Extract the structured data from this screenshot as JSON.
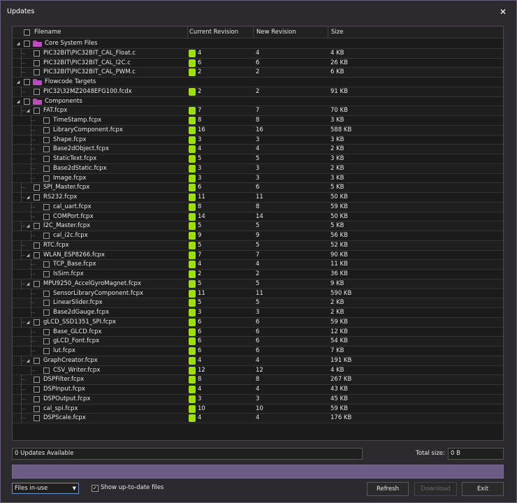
{
  "window": {
    "title": "Updates",
    "close_glyph": "✕"
  },
  "columns": {
    "filename": "Filename",
    "current": "Current Revision",
    "new": "New Revision",
    "size": "Size"
  },
  "colors": {
    "badge": "#9ee00f",
    "folder": "#c04bc0",
    "accent": "#6b5c85"
  },
  "rows": [
    {
      "level": 0,
      "expand": "collapse",
      "folder": true,
      "name": "Core System Files",
      "cur": "",
      "new": "",
      "size": ""
    },
    {
      "level": 1,
      "expand": "",
      "folder": false,
      "name": "PIC32BIT\\PIC32BIT_CAL_Float.c",
      "cur": "4",
      "new": "4",
      "size": "4 KB"
    },
    {
      "level": 1,
      "expand": "",
      "folder": false,
      "name": "PIC32BIT\\PIC32BIT_CAL_I2C.c",
      "cur": "6",
      "new": "6",
      "size": "26 KB"
    },
    {
      "level": 1,
      "expand": "",
      "folder": false,
      "name": "PIC32BIT\\PIC32BIT_CAL_PWM.c",
      "cur": "2",
      "new": "2",
      "size": "6 KB"
    },
    {
      "level": 0,
      "expand": "collapse",
      "folder": true,
      "name": "Flowcode Targets",
      "cur": "",
      "new": "",
      "size": ""
    },
    {
      "level": 1,
      "expand": "",
      "folder": false,
      "name": "PIC32\\32MZ2048EFG100.fcdx",
      "cur": "2",
      "new": "2",
      "size": "91 KB"
    },
    {
      "level": 0,
      "expand": "collapse",
      "folder": true,
      "name": "Components",
      "cur": "",
      "new": "",
      "size": ""
    },
    {
      "level": 1,
      "expand": "collapse",
      "folder": false,
      "name": "FAT.fcpx",
      "cur": "7",
      "new": "7",
      "size": "70 KB"
    },
    {
      "level": 2,
      "expand": "",
      "folder": false,
      "name": "TimeStamp.fcpx",
      "cur": "8",
      "new": "8",
      "size": "3 KB"
    },
    {
      "level": 2,
      "expand": "",
      "folder": false,
      "name": "LibraryComponent.fcpx",
      "cur": "16",
      "new": "16",
      "size": "588 KB"
    },
    {
      "level": 2,
      "expand": "",
      "folder": false,
      "name": "Shape.fcpx",
      "cur": "3",
      "new": "3",
      "size": "3 KB"
    },
    {
      "level": 2,
      "expand": "",
      "folder": false,
      "name": "Base2dObject.fcpx",
      "cur": "4",
      "new": "4",
      "size": "2 KB"
    },
    {
      "level": 2,
      "expand": "",
      "folder": false,
      "name": "StaticText.fcpx",
      "cur": "5",
      "new": "5",
      "size": "3 KB"
    },
    {
      "level": 2,
      "expand": "",
      "folder": false,
      "name": "Base2dStatic.fcpx",
      "cur": "3",
      "new": "3",
      "size": "2 KB"
    },
    {
      "level": 2,
      "expand": "",
      "folder": false,
      "name": "Image.fcpx",
      "cur": "3",
      "new": "3",
      "size": "3 KB"
    },
    {
      "level": 1,
      "expand": "",
      "folder": false,
      "name": "SPI_Master.fcpx",
      "cur": "6",
      "new": "6",
      "size": "5 KB"
    },
    {
      "level": 1,
      "expand": "collapse",
      "folder": false,
      "name": "RS232.fcpx",
      "cur": "11",
      "new": "11",
      "size": "50 KB"
    },
    {
      "level": 2,
      "expand": "",
      "folder": false,
      "name": "cal_uart.fcpx",
      "cur": "8",
      "new": "8",
      "size": "59 KB"
    },
    {
      "level": 2,
      "expand": "",
      "folder": false,
      "name": "COMPort.fcpx",
      "cur": "14",
      "new": "14",
      "size": "50 KB"
    },
    {
      "level": 1,
      "expand": "collapse",
      "folder": false,
      "name": "I2C_Master.fcpx",
      "cur": "5",
      "new": "5",
      "size": "5 KB"
    },
    {
      "level": 2,
      "expand": "",
      "folder": false,
      "name": "cal_i2c.fcpx",
      "cur": "9",
      "new": "9",
      "size": "56 KB"
    },
    {
      "level": 1,
      "expand": "",
      "folder": false,
      "name": "RTC.fcpx",
      "cur": "5",
      "new": "5",
      "size": "52 KB"
    },
    {
      "level": 1,
      "expand": "collapse",
      "folder": false,
      "name": "WLAN_ESP8266.fcpx",
      "cur": "7",
      "new": "7",
      "size": "90 KB"
    },
    {
      "level": 2,
      "expand": "",
      "folder": false,
      "name": "TCP_Base.fcpx",
      "cur": "4",
      "new": "4",
      "size": "11 KB"
    },
    {
      "level": 2,
      "expand": "",
      "folder": false,
      "name": "IsSim.fcpx",
      "cur": "2",
      "new": "2",
      "size": "36 KB"
    },
    {
      "level": 1,
      "expand": "collapse",
      "folder": false,
      "name": "MPU9250_AccelGyroMagnet.fcpx",
      "cur": "5",
      "new": "5",
      "size": "9 KB"
    },
    {
      "level": 2,
      "expand": "",
      "folder": false,
      "name": "SensorLibraryComponent.fcpx",
      "cur": "11",
      "new": "11",
      "size": "590 KB"
    },
    {
      "level": 2,
      "expand": "",
      "folder": false,
      "name": "LinearSlider.fcpx",
      "cur": "5",
      "new": "5",
      "size": "2 KB"
    },
    {
      "level": 2,
      "expand": "",
      "folder": false,
      "name": "Base2dGauge.fcpx",
      "cur": "3",
      "new": "3",
      "size": "2 KB"
    },
    {
      "level": 1,
      "expand": "collapse",
      "folder": false,
      "name": "gLCD_SSD1351_SPI.fcpx",
      "cur": "6",
      "new": "6",
      "size": "59 KB"
    },
    {
      "level": 2,
      "expand": "",
      "folder": false,
      "name": "Base_GLCD.fcpx",
      "cur": "6",
      "new": "6",
      "size": "12 KB"
    },
    {
      "level": 2,
      "expand": "",
      "folder": false,
      "name": "gLCD_Font.fcpx",
      "cur": "6",
      "new": "6",
      "size": "54 KB"
    },
    {
      "level": 2,
      "expand": "",
      "folder": false,
      "name": "lut.fcpx",
      "cur": "6",
      "new": "6",
      "size": "7 KB"
    },
    {
      "level": 1,
      "expand": "collapse",
      "folder": false,
      "name": "GraphCreator.fcpx",
      "cur": "4",
      "new": "4",
      "size": "191 KB"
    },
    {
      "level": 2,
      "expand": "",
      "folder": false,
      "name": "CSV_Writer.fcpx",
      "cur": "12",
      "new": "12",
      "size": "4 KB"
    },
    {
      "level": 1,
      "expand": "",
      "folder": false,
      "name": "DSPFilter.fcpx",
      "cur": "8",
      "new": "8",
      "size": "267 KB"
    },
    {
      "level": 1,
      "expand": "",
      "folder": false,
      "name": "DSPInput.fcpx",
      "cur": "4",
      "new": "4",
      "size": "43 KB"
    },
    {
      "level": 1,
      "expand": "",
      "folder": false,
      "name": "DSPOutput.fcpx",
      "cur": "3",
      "new": "3",
      "size": "45 KB"
    },
    {
      "level": 1,
      "expand": "",
      "folder": false,
      "name": "cal_spi.fcpx",
      "cur": "10",
      "new": "10",
      "size": "59 KB"
    },
    {
      "level": 1,
      "expand": "",
      "folder": false,
      "name": "DSPScale.fcpx",
      "cur": "4",
      "new": "4",
      "size": "176 KB"
    }
  ],
  "footer": {
    "updates_available": "0 Updates Available",
    "total_size_label": "Total size:",
    "total_size_value": "0 B",
    "filter_selected": "Files in-use",
    "show_uptodate_label": "Show up-to-date files",
    "show_uptodate_checked": "✓",
    "refresh_label": "Refresh",
    "download_label": "Download",
    "exit_label": "Exit"
  }
}
